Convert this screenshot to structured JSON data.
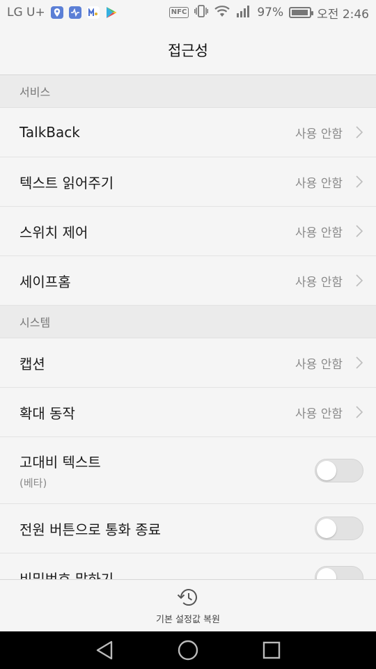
{
  "status_bar": {
    "carrier": "LG U+",
    "battery_percent": "97%",
    "battery_level": 0.97,
    "time": "오전 2:46",
    "nfc_label": "NFC",
    "icons": [
      "map-pin-icon",
      "health-icon",
      "m-app-icon",
      "play-store-icon",
      "nfc-icon",
      "vibrate-icon",
      "wifi-icon",
      "signal-icon",
      "battery-icon"
    ]
  },
  "header": {
    "title": "접근성"
  },
  "sections": {
    "services": {
      "header": "서비스",
      "items": [
        {
          "label": "TalkBack",
          "value": "사용 안함"
        },
        {
          "label": "텍스트 읽어주기",
          "value": "사용 안함"
        },
        {
          "label": "스위치 제어",
          "value": "사용 안함"
        },
        {
          "label": "세이프홈",
          "value": "사용 안함"
        }
      ]
    },
    "system": {
      "header": "시스템",
      "items": [
        {
          "label": "캡션",
          "value": "사용 안함"
        },
        {
          "label": "확대 동작",
          "value": "사용 안함"
        }
      ],
      "toggles": [
        {
          "label": "고대비 텍스트",
          "sub": "(베타)",
          "on": false
        },
        {
          "label": "전원 버튼으로 통화 종료",
          "on": false
        },
        {
          "label": "비밀번호 말하기",
          "on": false
        }
      ]
    }
  },
  "bottom": {
    "restore_label": "기본 설정값 복원",
    "icon": "restore-icon"
  },
  "nav": {
    "icons": [
      "back-icon",
      "home-icon",
      "recents-icon"
    ]
  }
}
